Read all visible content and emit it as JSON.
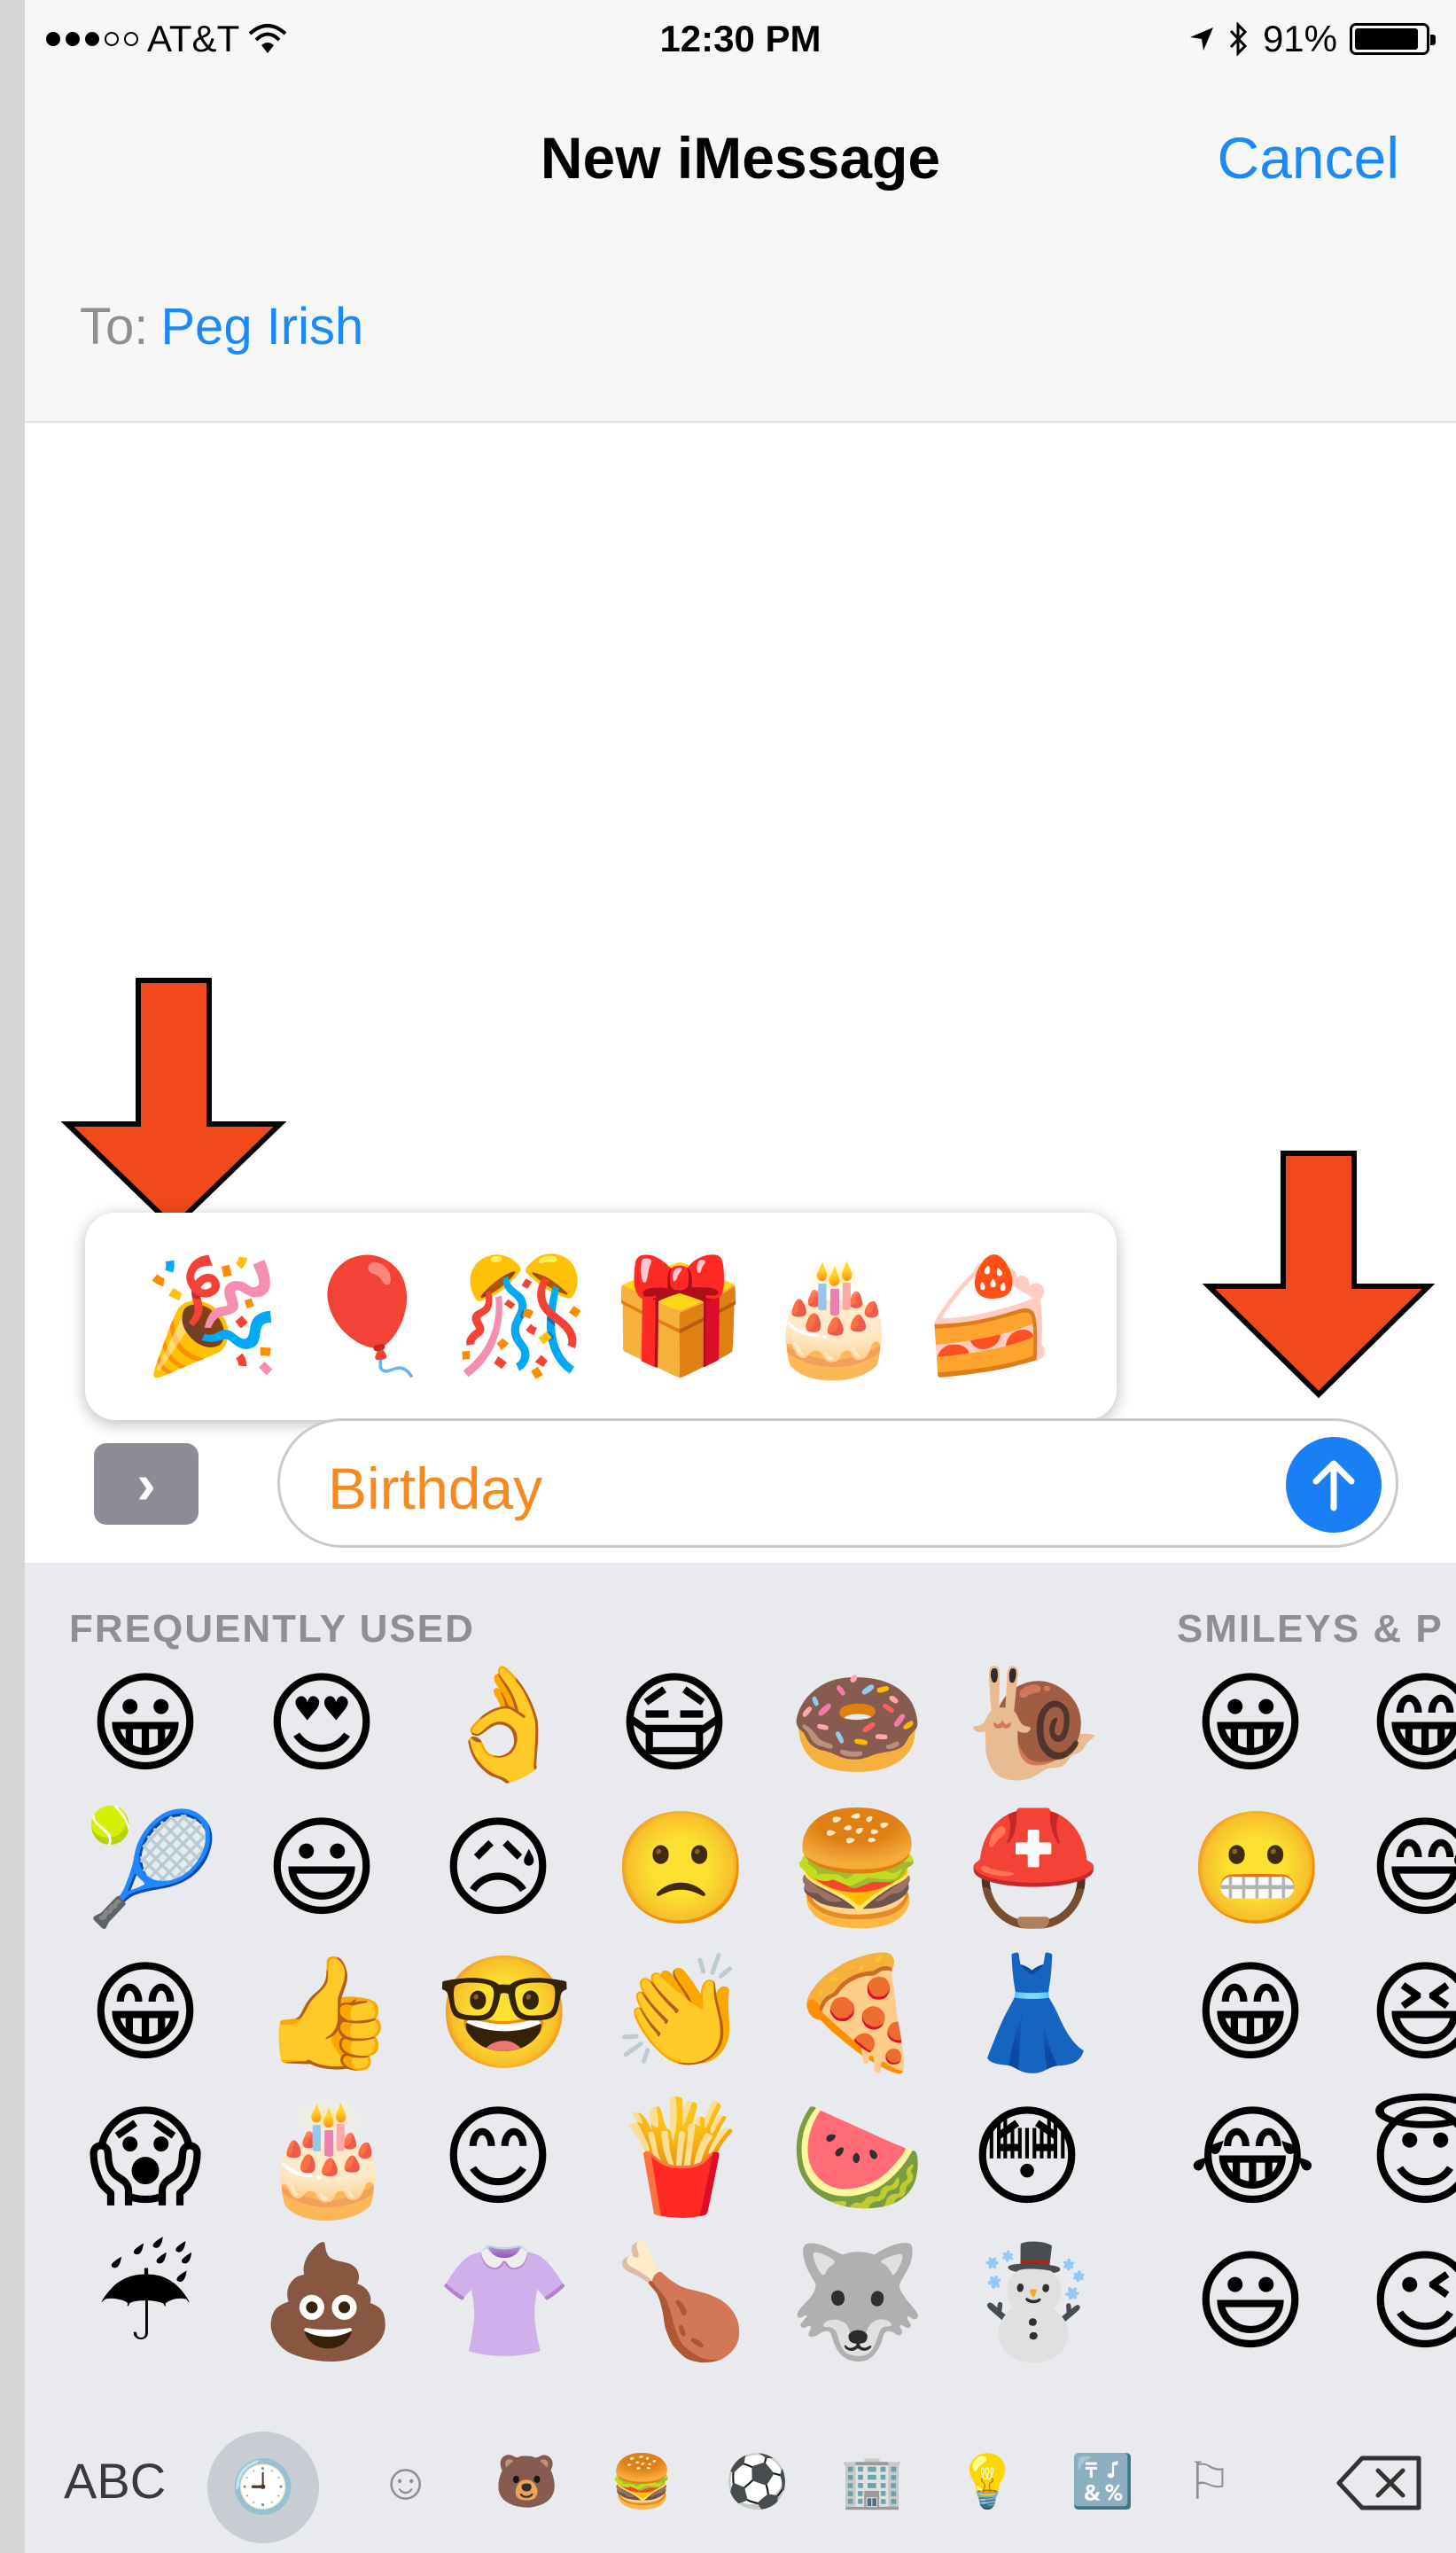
{
  "status_bar": {
    "carrier": "AT&T",
    "time": "12:30 PM",
    "battery": "91%",
    "battery_level": 0.91
  },
  "nav": {
    "title": "New iMessage",
    "cancel": "Cancel"
  },
  "to_field": {
    "label": "To:",
    "recipient": "Peg Irish"
  },
  "suggestions": [
    "🎉",
    "🎈",
    "🎊",
    "🎁",
    "🎂",
    "🍰"
  ],
  "composer": {
    "expand": "›",
    "text": "Birthday"
  },
  "keyboard": {
    "section_frequent": "FREQUENTLY USED",
    "section_smileys": "SMILEYS & P",
    "frequent_rows": [
      [
        "😀",
        "😍",
        "👌",
        "😷",
        "🍩",
        "🐌"
      ],
      [
        "🎾",
        "😃",
        "😥",
        "🙁",
        "🍔",
        "⛑️"
      ],
      [
        "😁",
        "👍",
        "🤓",
        "👏",
        "🍕",
        "👗"
      ],
      [
        "😱",
        "🎂",
        "😊",
        "🍟",
        "🍉",
        "😳"
      ],
      [
        "☔",
        "💩",
        "👚",
        "🍗",
        "🐺",
        "☃️"
      ]
    ],
    "smiley_rows": [
      [
        "😀",
        "😁"
      ],
      [
        "😬",
        "😅"
      ],
      [
        "😁",
        "😆"
      ],
      [
        "😂",
        "😇"
      ],
      [
        "😃",
        "😉"
      ]
    ],
    "bottom": {
      "abc": "ABC",
      "tabs": [
        "🕘",
        "☺",
        "🐻",
        "🍔",
        "⚽",
        "🏢",
        "💡",
        "🔣",
        "⚐"
      ],
      "delete": "⌫"
    }
  }
}
